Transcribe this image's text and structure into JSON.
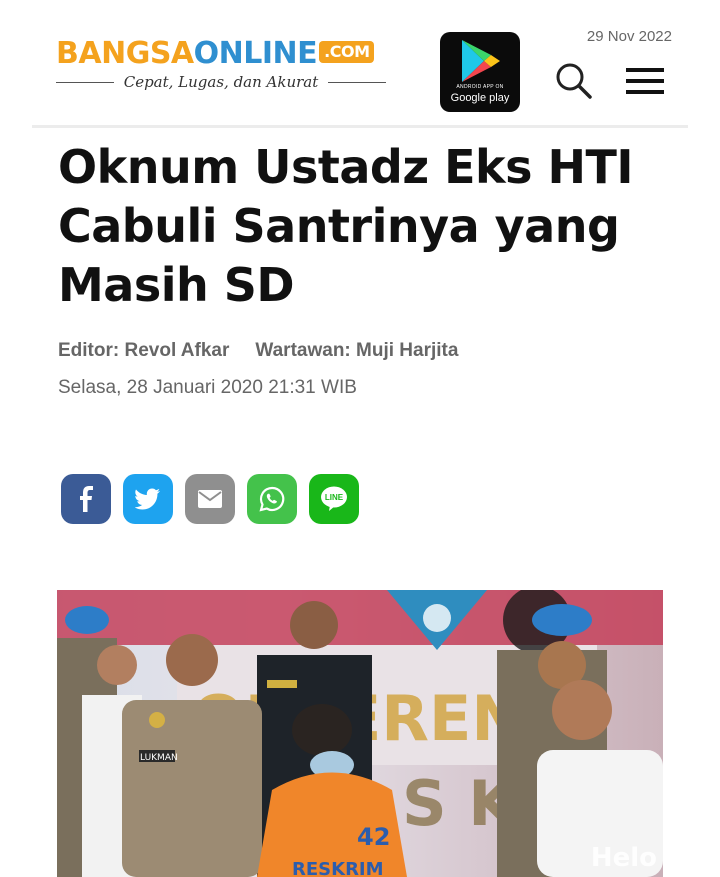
{
  "header": {
    "logo": {
      "part1": "BANGSA",
      "part2": "ONLINE",
      "part3": ".COM",
      "tagline": "Cepat, Lugas, dan Akurat"
    },
    "app_badge": {
      "small_text": "ANDROID APP ON",
      "text": "Google play"
    },
    "date": "29 Nov 2022",
    "icons": [
      "google-play-icon",
      "search-icon",
      "hamburger-menu-icon"
    ]
  },
  "article": {
    "title": "Oknum Ustadz Eks HTI Cabuli Santrinya yang Masih SD",
    "editor": "Editor: Revol Afkar",
    "reporter": "Wartawan: Muji Harjita",
    "published": "Selasa, 28 Januari 2020 21:31 WIB"
  },
  "share": {
    "buttons": [
      "facebook",
      "twitter",
      "email",
      "whatsapp",
      "line"
    ],
    "line_label": "LINE",
    "colors": {
      "facebook": "#3b5b96",
      "twitter": "#1ea3ef",
      "email": "#8f8f8f",
      "whatsapp": "#44c24b",
      "line": "#19b719"
    }
  },
  "photo": {
    "jersey_number": "42",
    "jersey_text": "RESKRIM",
    "watermark": "Helo"
  }
}
